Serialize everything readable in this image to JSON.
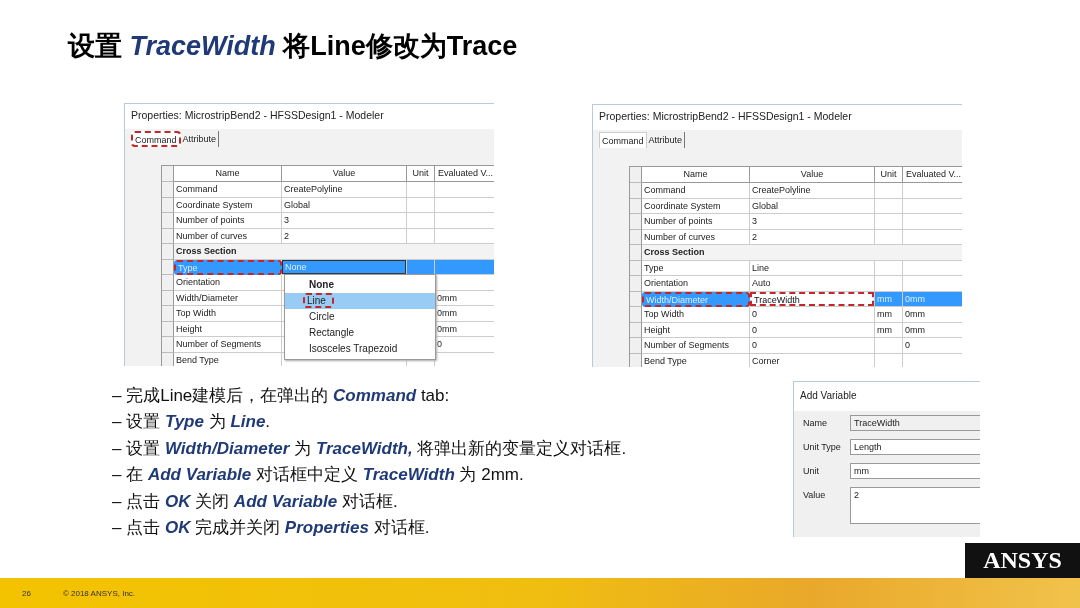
{
  "title": "设置 *TraceWidth* 将Line修改为Trace",
  "panels": [
    {
      "title": "Properties: MicrostripBend2 - HFSSDesign1 - Modeler",
      "tabs": [
        {
          "label": "Command",
          "selected": true,
          "highlighted": true
        },
        {
          "label": "Attribute",
          "selected": false,
          "highlighted": false
        }
      ],
      "columns": [
        "Name",
        "Value",
        "Unit",
        "Evaluated V..."
      ],
      "rows": [
        {
          "kind": "row",
          "name": "Command",
          "value": "CreatePolyline",
          "selected": false,
          "name_highlighted": false,
          "value_highlighted": false
        },
        {
          "kind": "row",
          "name": "Coordinate System",
          "value": "Global",
          "selected": false,
          "name_highlighted": false,
          "value_highlighted": false
        },
        {
          "kind": "row",
          "name": "Number of points",
          "value": "3",
          "selected": false,
          "name_highlighted": false,
          "value_highlighted": false
        },
        {
          "kind": "row",
          "name": "Number of curves",
          "value": "2",
          "selected": false,
          "name_highlighted": false,
          "value_highlighted": false
        },
        {
          "kind": "section",
          "name": "Cross Section",
          "selected": false
        },
        {
          "kind": "row",
          "name": "Type",
          "value": "None",
          "selected": true,
          "editing": true,
          "name_highlighted": true,
          "value_highlighted": false
        },
        {
          "kind": "row",
          "name": "Orientation",
          "selected": false,
          "name_highlighted": false,
          "value_highlighted": false
        },
        {
          "kind": "row",
          "name": "Width/Diameter",
          "evaluated": "0mm",
          "selected": false,
          "name_highlighted": false,
          "value_highlighted": false
        },
        {
          "kind": "row",
          "name": "Top Width",
          "evaluated": "0mm",
          "selected": false,
          "name_highlighted": false,
          "value_highlighted": false
        },
        {
          "kind": "row",
          "name": "Height",
          "evaluated": "0mm",
          "selected": false,
          "name_highlighted": false,
          "value_highlighted": false
        },
        {
          "kind": "row",
          "name": "Number of Segments",
          "evaluated": "0",
          "selected": false,
          "name_highlighted": false,
          "value_highlighted": false
        },
        {
          "kind": "row",
          "name": "Bend Type",
          "selected": false,
          "name_highlighted": false,
          "value_highlighted": false
        }
      ],
      "dropdown": {
        "options": [
          {
            "label": "None",
            "selected": true,
            "highlighted": false
          },
          {
            "label": "Line",
            "selected": false,
            "highlighted": true
          },
          {
            "label": "Circle",
            "selected": false,
            "highlighted": false
          },
          {
            "label": "Rectangle",
            "selected": false,
            "highlighted": false
          },
          {
            "label": "Isosceles Trapezoid",
            "selected": false,
            "highlighted": false
          }
        ]
      }
    },
    {
      "title": "Properties: MicrostripBend2 - HFSSDesign1 - Modeler",
      "tabs": [
        {
          "label": "Command",
          "selected": true,
          "highlighted": false
        },
        {
          "label": "Attribute",
          "selected": false,
          "highlighted": false
        }
      ],
      "columns": [
        "Name",
        "Value",
        "Unit",
        "Evaluated V..."
      ],
      "rows": [
        {
          "kind": "row",
          "name": "Command",
          "value": "CreatePolyline",
          "selected": false,
          "name_highlighted": false,
          "value_highlighted": false
        },
        {
          "kind": "row",
          "name": "Coordinate System",
          "value": "Global",
          "selected": false,
          "name_highlighted": false,
          "value_highlighted": false
        },
        {
          "kind": "row",
          "name": "Number of points",
          "value": "3",
          "selected": false,
          "name_highlighted": false,
          "value_highlighted": false
        },
        {
          "kind": "row",
          "name": "Number of curves",
          "value": "2",
          "selected": false,
          "name_highlighted": false,
          "value_highlighted": false
        },
        {
          "kind": "section",
          "name": "Cross Section",
          "selected": false
        },
        {
          "kind": "row",
          "name": "Type",
          "value": "Line",
          "selected": false,
          "name_highlighted": false,
          "value_highlighted": false
        },
        {
          "kind": "row",
          "name": "Orientation",
          "value": "Auto",
          "selected": false,
          "name_highlighted": false,
          "value_highlighted": false
        },
        {
          "kind": "row",
          "name": "Width/Diameter",
          "value": "TraceWidth",
          "unit": "mm",
          "evaluated": "0mm",
          "selected": true,
          "editing": true,
          "name_highlighted": true,
          "value_highlighted": true
        },
        {
          "kind": "row",
          "name": "Top Width",
          "value": "0",
          "unit": "mm",
          "evaluated": "0mm",
          "selected": false,
          "name_highlighted": false,
          "value_highlighted": false
        },
        {
          "kind": "row",
          "name": "Height",
          "value": "0",
          "unit": "mm",
          "evaluated": "0mm",
          "selected": false,
          "name_highlighted": false,
          "value_highlighted": false
        },
        {
          "kind": "row",
          "name": "Number of Segments",
          "value": "0",
          "evaluated": "0",
          "selected": false,
          "name_highlighted": false,
          "value_highlighted": false
        },
        {
          "kind": "row",
          "name": "Bend Type",
          "value": "Corner",
          "selected": false,
          "name_highlighted": false,
          "value_highlighted": false
        }
      ]
    }
  ],
  "bullets": [
    "– 完成Line建模后，在弹出的 **Command** tab:",
    "– 设置 **Type** 为 **Line**.",
    "– 设置 **Width/Diameter** 为 **TraceWidth,** 将弹出新的变量定义对话框.",
    "– 在 **Add Variable** 对话框中定义 **TraceWidth** 为 2mm.",
    "– 点击 **OK** 关闭 **Add Variable** 对话框.",
    "– 点击 **OK** 完成并关闭 **Properties** 对话框."
  ],
  "add_variable": {
    "title": "Add Variable",
    "fields": [
      {
        "label": "Name",
        "value": "TraceWidth",
        "kind": "readonly"
      },
      {
        "label": "Unit Type",
        "value": "Length",
        "kind": "text"
      },
      {
        "label": "Unit",
        "value": "mm",
        "kind": "text"
      },
      {
        "label": "Value",
        "value": "2",
        "kind": "multiline"
      }
    ]
  },
  "footer": {
    "page": "26",
    "copyright": "© 2018 ANSYS, Inc.",
    "logo": "ANSYS"
  }
}
